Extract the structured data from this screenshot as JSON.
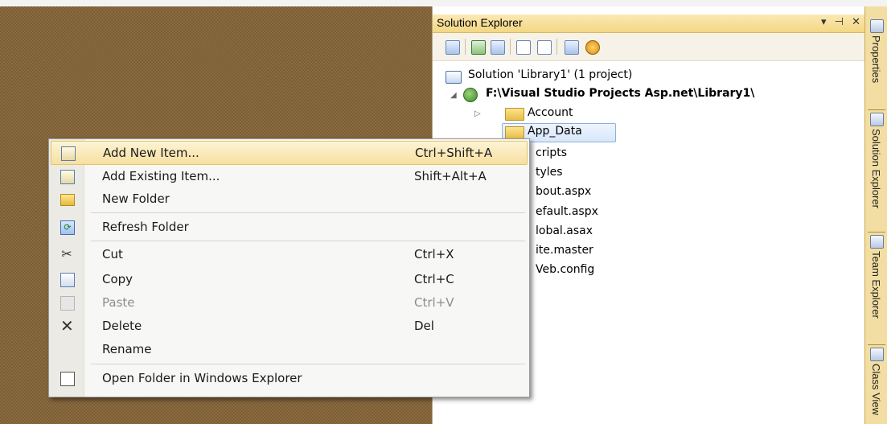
{
  "solution_explorer": {
    "title": "Solution Explorer",
    "title_controls": {
      "dropdown": "▾",
      "pin": "⊣",
      "close": "✕"
    },
    "toolbar_icons": [
      "properties-icon",
      "refresh-icon",
      "show-all-files-icon",
      "view-code-icon",
      "view-designer-icon",
      "view-class-diagram-icon",
      "nested-related-files-icon"
    ],
    "tree": {
      "solution": "Solution 'Library1' (1 project)",
      "project": "F:\\Visual Studio Projects Asp.net\\Library1\\",
      "items": [
        {
          "label": "Account",
          "kind": "folder",
          "expandable": true
        },
        {
          "label": "App_Data",
          "kind": "folder",
          "selected": true
        },
        {
          "label": "cripts",
          "kind": "folder"
        },
        {
          "label": "tyles",
          "kind": "folder"
        },
        {
          "label": "bout.aspx",
          "kind": "file"
        },
        {
          "label": "efault.aspx",
          "kind": "file"
        },
        {
          "label": "lobal.asax",
          "kind": "file"
        },
        {
          "label": "ite.master",
          "kind": "file"
        },
        {
          "label": "Veb.config",
          "kind": "file"
        }
      ]
    }
  },
  "side_tabs": [
    {
      "label": "Properties",
      "icon": "properties-icon"
    },
    {
      "label": "Solution Explorer",
      "icon": "solution-explorer-icon"
    },
    {
      "label": "Team Explorer",
      "icon": "team-explorer-icon"
    },
    {
      "label": "Class View",
      "icon": "class-view-icon"
    }
  ],
  "context_menu": {
    "items": [
      {
        "label": "Add New Item...",
        "shortcut": "Ctrl+Shift+A",
        "icon": "add-new-item-icon",
        "highlighted": true
      },
      {
        "label": "Add Existing Item...",
        "shortcut": "Shift+Alt+A",
        "icon": "add-existing-item-icon"
      },
      {
        "label": "New Folder",
        "shortcut": "",
        "icon": "new-folder-icon"
      },
      {
        "label": "Refresh Folder",
        "shortcut": "",
        "icon": "refresh-folder-icon"
      },
      {
        "label": "Cut",
        "shortcut": "Ctrl+X",
        "icon": "cut-icon"
      },
      {
        "label": "Copy",
        "shortcut": "Ctrl+C",
        "icon": "copy-icon"
      },
      {
        "label": "Paste",
        "shortcut": "Ctrl+V",
        "icon": "paste-icon",
        "disabled": true
      },
      {
        "label": "Delete",
        "shortcut": "Del",
        "icon": "delete-icon"
      },
      {
        "label": "Rename",
        "shortcut": "",
        "icon": ""
      },
      {
        "label": "Open Folder in Windows Explorer",
        "shortcut": "",
        "icon": "open-folder-icon"
      }
    ]
  }
}
